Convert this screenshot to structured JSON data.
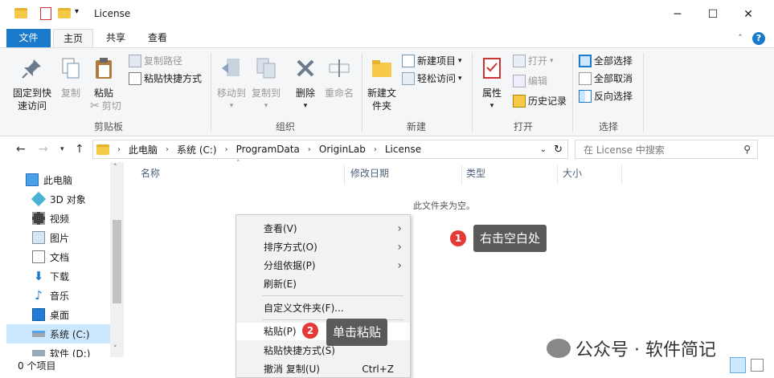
{
  "window": {
    "title": "License",
    "controls": [
      "minimize-icon",
      "maximize-icon",
      "close-icon"
    ]
  },
  "ribbon_tabs": [
    "文件",
    "主页",
    "共享",
    "查看"
  ],
  "ribbon": {
    "clipboard": {
      "pin": "固定到快速访问",
      "copy": "复制",
      "paste": "粘贴",
      "copy_path": "复制路径",
      "paste_shortcut": "粘贴快捷方式",
      "cut": "剪切",
      "group": "剪贴板"
    },
    "organize": {
      "move_to": "移动到",
      "copy_to": "复制到",
      "delete": "删除",
      "rename": "重命名",
      "group": "组织"
    },
    "new": {
      "new_folder": "新建文件夹",
      "new_item": "新建项目",
      "easy_access": "轻松访问",
      "group": "新建"
    },
    "open": {
      "properties": "属性",
      "open": "打开",
      "edit": "编辑",
      "history": "历史记录",
      "group": "打开"
    },
    "select": {
      "select_all": "全部选择",
      "select_none": "全部取消",
      "invert": "反向选择",
      "group": "选择"
    }
  },
  "address": {
    "crumbs": [
      "此电脑",
      "系统 (C:)",
      "ProgramData",
      "OriginLab",
      "License"
    ],
    "search_placeholder": "在 License 中搜索"
  },
  "nav": {
    "items": [
      "此电脑",
      "3D 对象",
      "视频",
      "图片",
      "文档",
      "下载",
      "音乐",
      "桌面",
      "系统 (C:)",
      "软件 (D:)"
    ]
  },
  "columns": [
    "名称",
    "修改日期",
    "类型",
    "大小"
  ],
  "empty_text": "此文件夹为空。",
  "context_menu": {
    "view": "查看(V)",
    "sort": "排序方式(O)",
    "group": "分组依据(P)",
    "refresh": "刷新(E)",
    "customize": "自定义文件夹(F)...",
    "paste": "粘贴(P)",
    "paste_shortcut": "粘贴快捷方式(S)",
    "undo": "撤消 复制(U)",
    "undo_shortcut": "Ctrl+Z"
  },
  "annotations": {
    "step1_num": "1",
    "step1_text": "右击空白处",
    "step2_num": "2",
    "step2_text": "单击粘贴"
  },
  "status": {
    "count": "0 个项目"
  },
  "watermark": "公众号 · 软件简记",
  "colors": {
    "file_tab": "#1979ca",
    "badge": "#e53935",
    "bubble": "#5a5a5a",
    "selection": "#cce8ff"
  }
}
